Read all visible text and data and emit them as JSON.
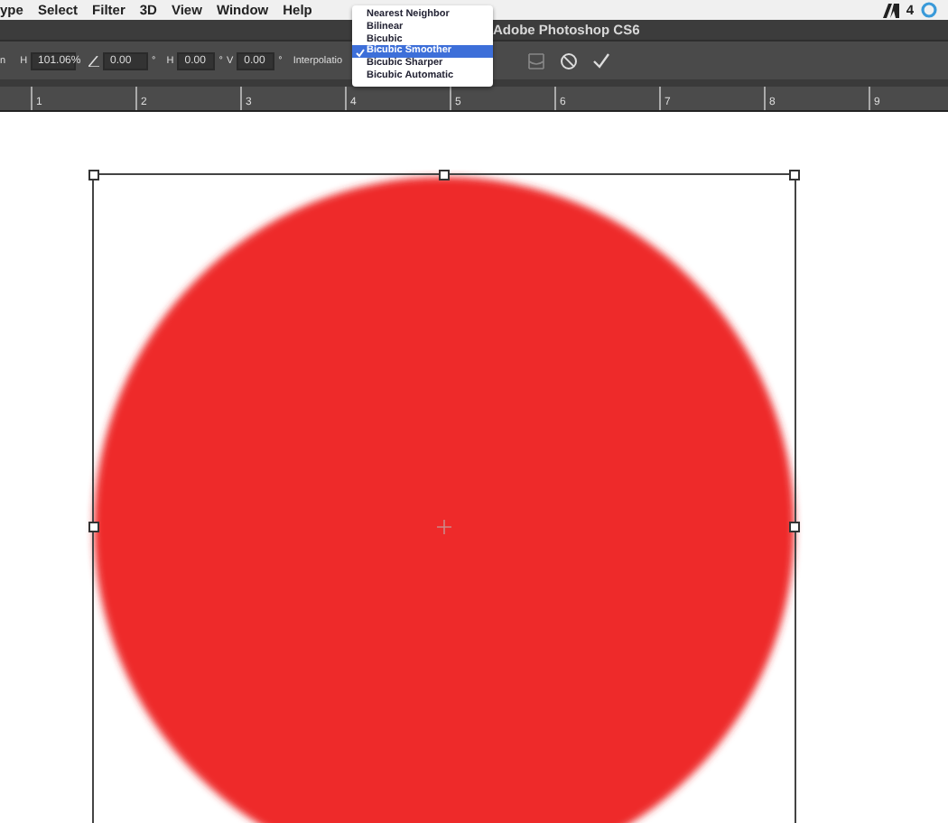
{
  "menu_bar": {
    "items": [
      "ype",
      "Select",
      "Filter",
      "3D",
      "View",
      "Window",
      "Help"
    ],
    "badge": "4"
  },
  "window": {
    "title": "Adobe Photoshop CS6"
  },
  "options_bar": {
    "cut_label": "n",
    "width_label": "H",
    "width_value": "101.06%",
    "angle_value": "0.00",
    "angle_unit": "°",
    "h_skew_label": "H",
    "h_skew_value": "0.00",
    "h_skew_unit": "°",
    "v_skew_label": "V",
    "v_skew_value": "0.00",
    "v_skew_unit": "°",
    "interpolation_label": "Interpolatio"
  },
  "interpolation_menu": [
    {
      "label": "Nearest Neighbor",
      "selected": false
    },
    {
      "label": "Bilinear",
      "selected": false
    },
    {
      "label": "Bicubic",
      "selected": false
    },
    {
      "label": "Bicubic Smoother",
      "selected": true
    },
    {
      "label": "Bicubic Sharper",
      "selected": false
    },
    {
      "label": "Bicubic Automatic",
      "selected": false
    }
  ],
  "ruler": [
    "1",
    "2",
    "3",
    "4",
    "5",
    "6",
    "7",
    "8",
    "9"
  ]
}
